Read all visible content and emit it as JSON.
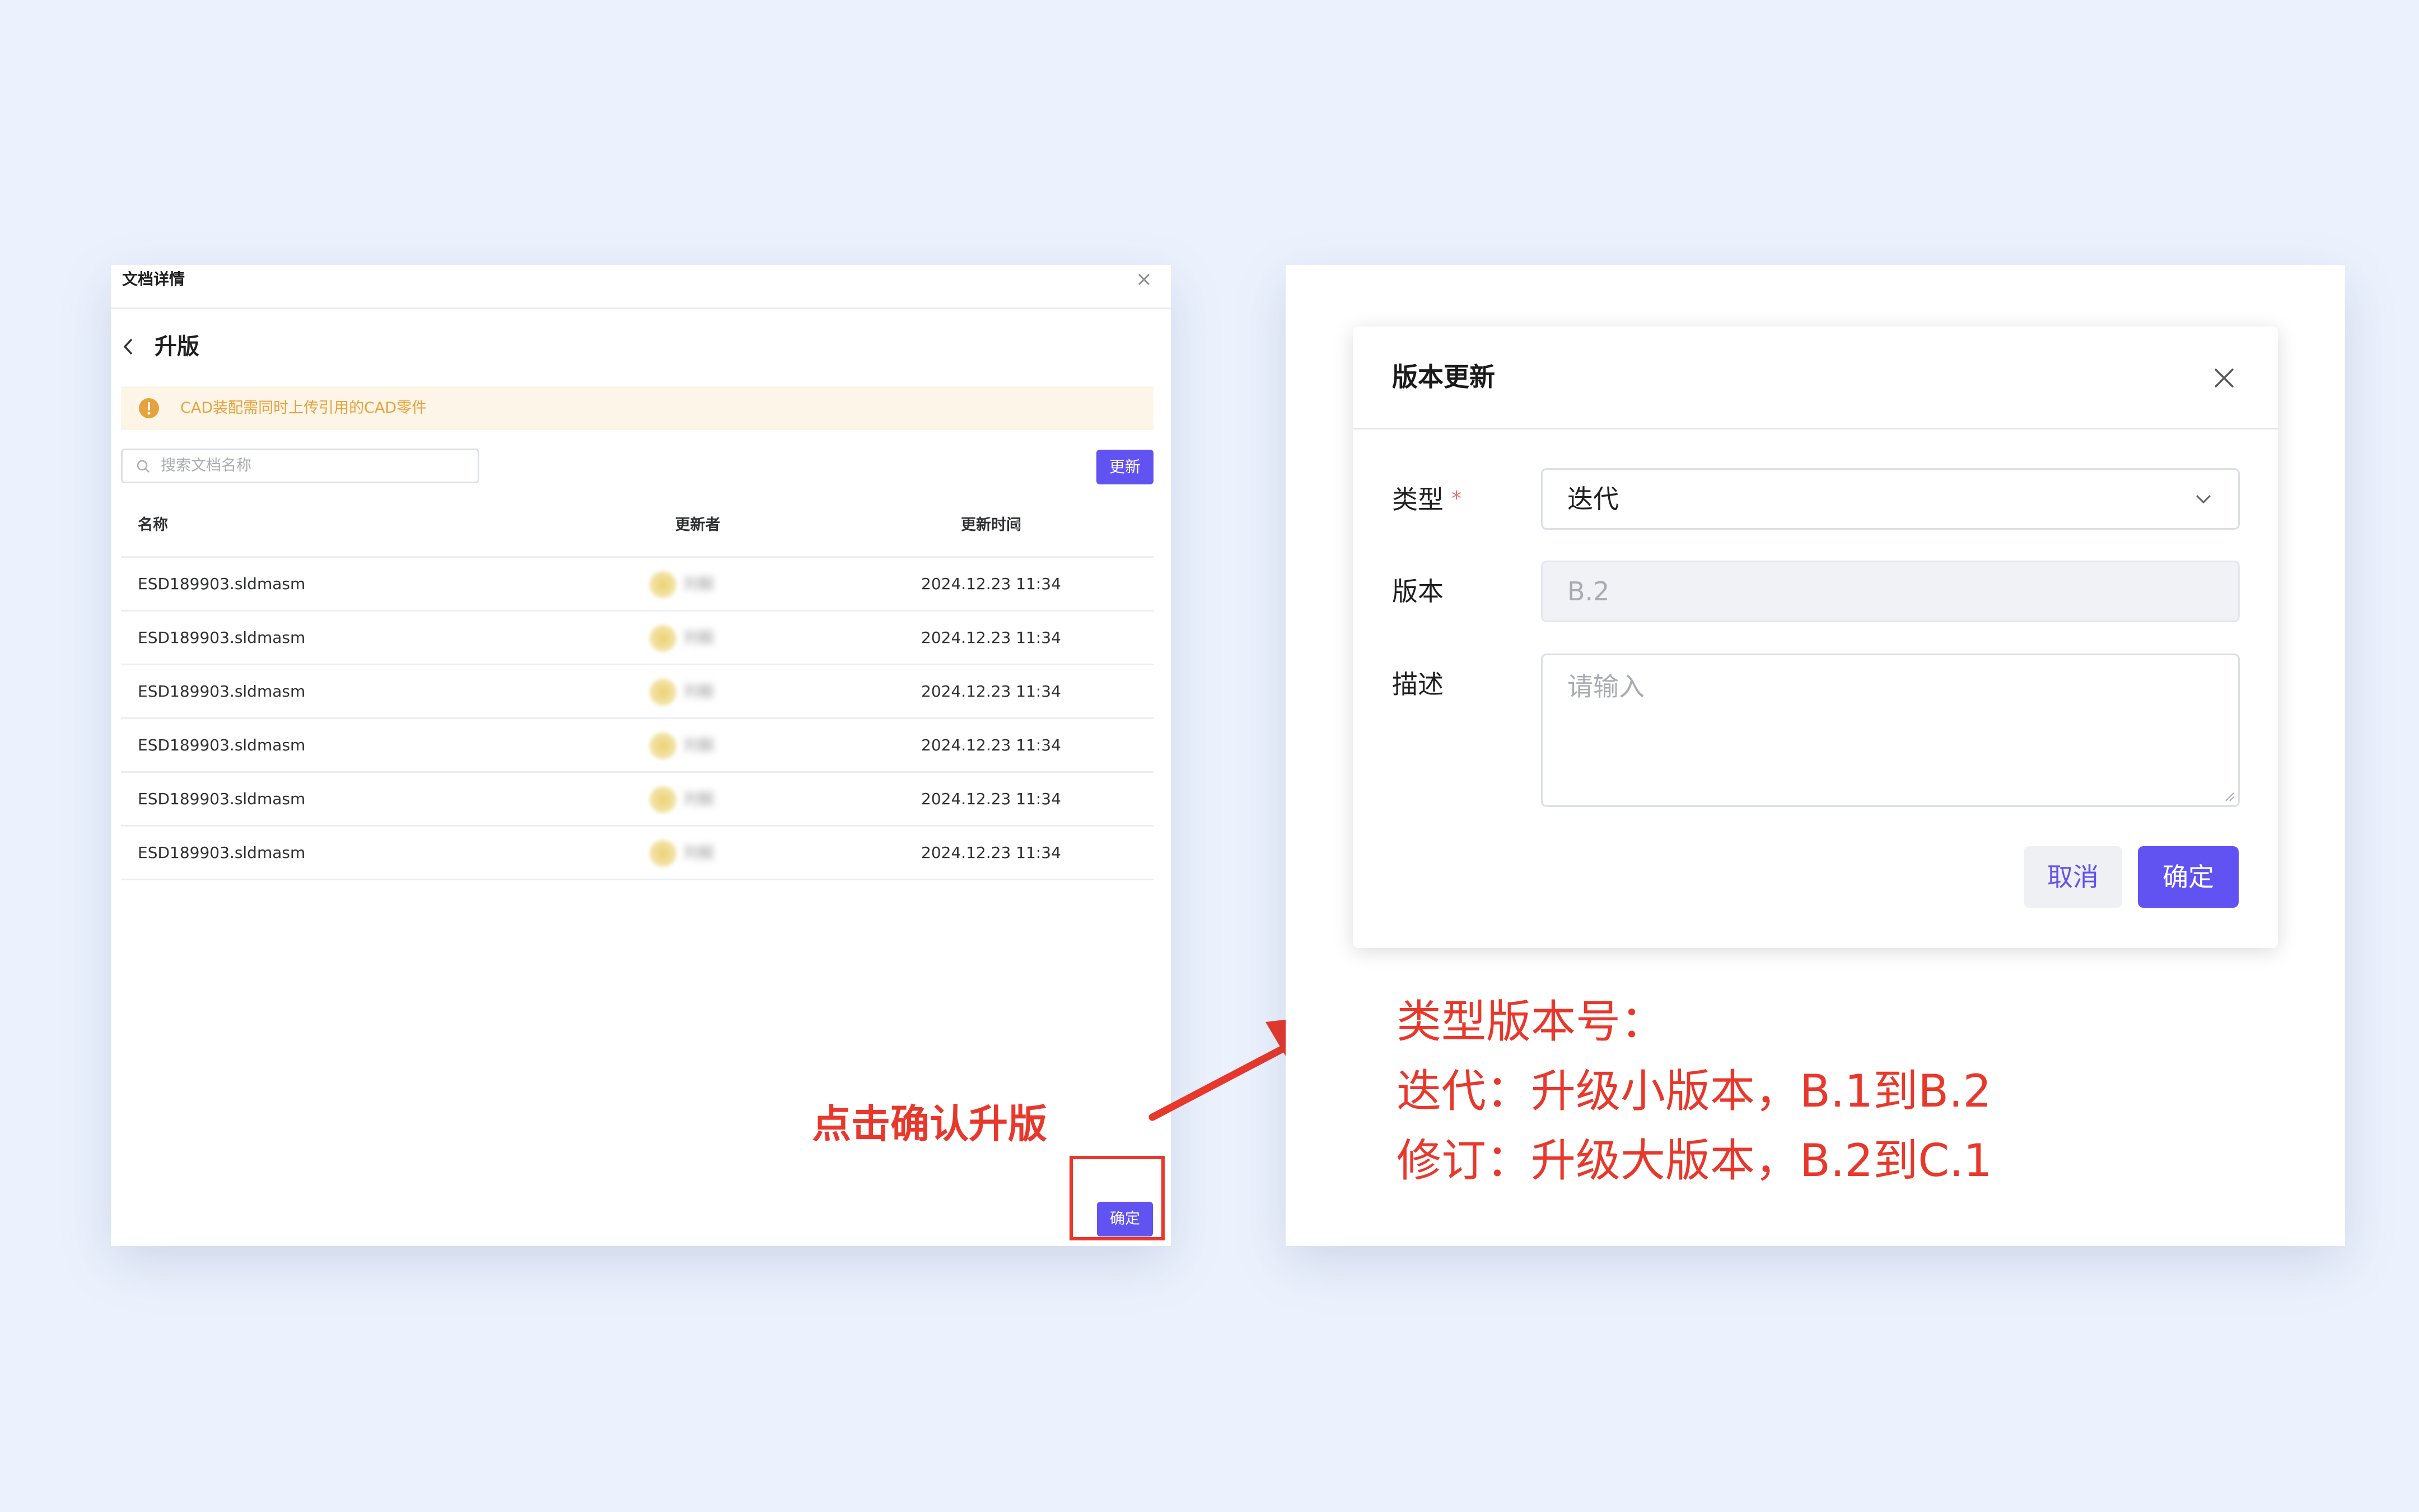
{
  "left_panel": {
    "title": "文档详情",
    "subtitle": "升版",
    "alert": "CAD装配需同时上传引用的CAD零件",
    "search_placeholder": "搜索文档名称",
    "update_button": "更新",
    "table": {
      "headers": {
        "name": "名称",
        "updater": "更新者",
        "time": "更新时间"
      },
      "rows": [
        {
          "name": "ESD189903.sldmasm",
          "user": "刘毅",
          "time": "2024.12.23 11:34"
        },
        {
          "name": "ESD189903.sldmasm",
          "user": "刘毅",
          "time": "2024.12.23 11:34"
        },
        {
          "name": "ESD189903.sldmasm",
          "user": "刘毅",
          "time": "2024.12.23 11:34"
        },
        {
          "name": "ESD189903.sldmasm",
          "user": "刘毅",
          "time": "2024.12.23 11:34"
        },
        {
          "name": "ESD189903.sldmasm",
          "user": "刘毅",
          "time": "2024.12.23 11:34"
        },
        {
          "name": "ESD189903.sldmasm",
          "user": "刘毅",
          "time": "2024.12.23 11:34"
        }
      ]
    },
    "confirm_button": "确定"
  },
  "annotation": {
    "text": "点击确认升版",
    "color": "#e8382c"
  },
  "dialog": {
    "title": "版本更新",
    "fields": {
      "type": {
        "label": "类型",
        "required_mark": "*",
        "value": "迭代"
      },
      "version": {
        "label": "版本",
        "value": "B.2"
      },
      "description": {
        "label": "描述",
        "placeholder": "请输入"
      }
    },
    "cancel_button": "取消",
    "ok_button": "确定"
  },
  "notes": [
    "类型版本号：",
    "迭代：升级小版本，B.1到B.2",
    "修订：升级大版本，B.2到C.1"
  ],
  "colors": {
    "background": "#ecf2fd",
    "primary": "#6152f2",
    "warning": "#e6a23c",
    "annotation_red": "#e8382c"
  },
  "icons": [
    "close-icon",
    "chevron-left-icon",
    "warning-icon",
    "search-icon",
    "sort-icon",
    "chevron-down-icon",
    "arrow-icon"
  ]
}
